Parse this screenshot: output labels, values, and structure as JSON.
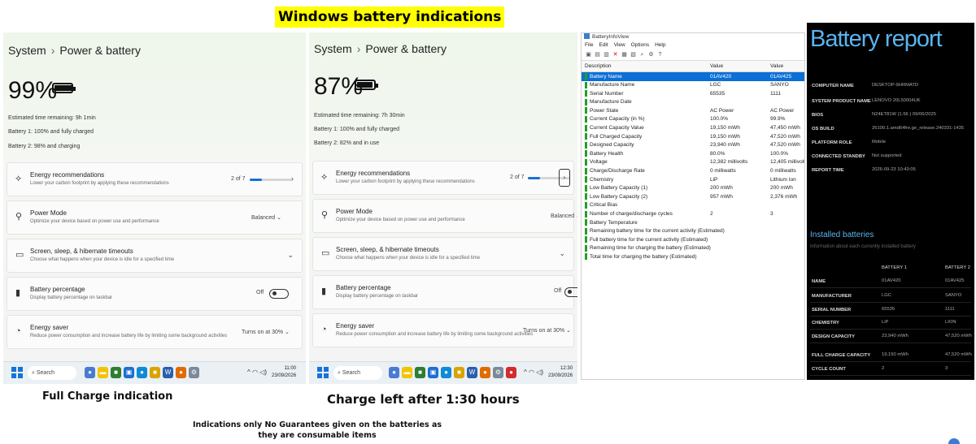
{
  "heading": "Windows battery indications",
  "panel1": {
    "breadcrumb_root": "System",
    "breadcrumb_page": "Power & battery",
    "percent": "99%",
    "fill": 0.99,
    "info": [
      "Estimated time remaining: 9h 1min",
      "Battery 1: 100% and fully charged",
      "Battery 2: 98% and charging"
    ],
    "energy_title": "Energy recommendations",
    "energy_sub": "Lower your carbon footprint by applying these recommendations",
    "energy_count": "2 of 7",
    "energy_progress": 0.28,
    "power_mode_title": "Power Mode",
    "power_mode_sub": "Optimize your device based on power use and performance",
    "power_mode_value": "Balanced",
    "screen_title": "Screen, sleep, & hibernate timeouts",
    "screen_sub": "Choose what happens when your device is idle for a specified time",
    "pct_title": "Battery percentage",
    "pct_sub": "Display battery percentage on taskbar",
    "pct_value": "Off",
    "saver_title": "Energy saver",
    "saver_sub": "Reduce power consumption and increase battery life by limiting some background activities",
    "saver_value": "Turns on at 30%",
    "taskbar_search": "Search",
    "time": "11:00",
    "date": "23/09/2026"
  },
  "panel2": {
    "breadcrumb_root": "System",
    "breadcrumb_page": "Power & battery",
    "percent": "87%",
    "fill": 0.87,
    "info": [
      "Estimated time remaining: 7h 30min",
      "Battery 1: 100% and fully charged",
      "Battery 2: 82% and in use"
    ],
    "energy_title": "Energy recommendations",
    "energy_sub": "Lower your carbon footprint by applying these recommendations",
    "energy_count": "2 of 7",
    "energy_progress": 0.28,
    "power_mode_title": "Power Mode",
    "power_mode_sub": "Optimize your device based on power use and performance",
    "power_mode_value": "Balanced",
    "screen_title": "Screen, sleep, & hibernate timeouts",
    "screen_sub": "Choose what happens when your device is idle for a specified time",
    "pct_title": "Battery percentage",
    "pct_sub": "Display battery percentage on taskbar",
    "pct_value": "Off",
    "saver_title": "Energy saver",
    "saver_sub": "Reduce power consumption and increase battery life by limiting some background activities",
    "saver_value": "Turns on at 30%",
    "taskbar_search": "Search",
    "time": "12:30",
    "date": "23/09/2026"
  },
  "batteryinfoview": {
    "title": "BatteryInfoView",
    "menu": [
      "File",
      "Edit",
      "View",
      "Options",
      "Help"
    ],
    "columns": [
      "Description",
      "Value",
      "Value"
    ],
    "rows": [
      [
        "Battery Name",
        "01AV420",
        "01AV425"
      ],
      [
        "Manufacture Name",
        "LGC",
        "SANYO"
      ],
      [
        "Serial Number",
        "65535",
        "1111"
      ],
      [
        "Manufacture Date",
        "",
        ""
      ],
      [
        "Power State",
        "AC Power",
        "AC Power"
      ],
      [
        "Current Capacity (in %)",
        "100.0%",
        "99.9%"
      ],
      [
        "Current Capacity Value",
        "19,150 mWh",
        "47,450 mWh"
      ],
      [
        "Full Charged Capacity",
        "19,150 mWh",
        "47,520 mWh"
      ],
      [
        "Designed Capacity",
        "23,940 mWh",
        "47,520 mWh"
      ],
      [
        "Battery Health",
        "80.0%",
        "100.0%"
      ],
      [
        "Voltage",
        "12,382 millivolts",
        "12,405 millivolts"
      ],
      [
        "Charge/Discharge Rate",
        "0 milliwatts",
        "0 milliwatts"
      ],
      [
        "Chemistry",
        "LiP",
        "Lithium Ion"
      ],
      [
        "Low Battery Capacity (1)",
        "200 mWh",
        "200 mWh"
      ],
      [
        "Low Battery Capacity (2)",
        "957 mWh",
        "2,376 mWh"
      ],
      [
        "Critical Bias",
        "",
        ""
      ],
      [
        "Number of charge/discharge cycles",
        "2",
        "3"
      ],
      [
        "Battery Temperature",
        "",
        ""
      ],
      [
        "Remaining battery time for the current activity (Estimated)",
        "",
        ""
      ],
      [
        "Full battery time for the current activity (Estimated)",
        "",
        ""
      ],
      [
        "Remaining time for charging the battery (Estimated)",
        "",
        ""
      ],
      [
        "Total time for charging the battery (Estimated)",
        "",
        ""
      ]
    ]
  },
  "report": {
    "title": "Battery report",
    "system_info": [
      [
        "COMPUTER NAME",
        "DESKTOP-9HRMATD"
      ],
      [
        "SYSTEM PRODUCT NAME",
        "LENOVO 20L50004UK"
      ],
      [
        "BIOS",
        "N24ET81W (1.56 ) 09/06/2025"
      ],
      [
        "OS BUILD",
        "26100.1.amd64fre.ge_release.240331-1435"
      ],
      [
        "PLATFORM ROLE",
        "Mobile"
      ],
      [
        "CONNECTED STANDBY",
        "Not supported"
      ],
      [
        "REPORT TIME",
        "2026-09-23  10:43:05"
      ]
    ],
    "installed_title": "Installed batteries",
    "installed_sub": "Information about each currently installed battery",
    "battery_headers": [
      "BATTERY 1",
      "BATTERY 2"
    ],
    "battery_rows": [
      [
        "NAME",
        "01AV420",
        "01AV425"
      ],
      [
        "MANUFACTURER",
        "LGC",
        "SANYO"
      ],
      [
        "SERIAL NUMBER",
        "65535",
        "1111"
      ],
      [
        "CHEMISTRY",
        "LiP",
        "LION"
      ],
      [
        "DESIGN CAPACITY",
        "23,940 mWh",
        "47,520 mWh"
      ],
      [
        "FULL CHARGE CAPACITY",
        "19,150 mWh",
        "47,520 mWh"
      ],
      [
        "CYCLE COUNT",
        "2",
        "3"
      ]
    ]
  },
  "captions": {
    "left": "Full Charge indication",
    "middle": "Charge left after 1:30 hours",
    "note": "Indications only No Guarantees given on the batteries as they are consumable items"
  },
  "colors": {
    "accent": "#1a6fd1",
    "highlight": "#ffff00",
    "report_title": "#5ab4f0"
  }
}
